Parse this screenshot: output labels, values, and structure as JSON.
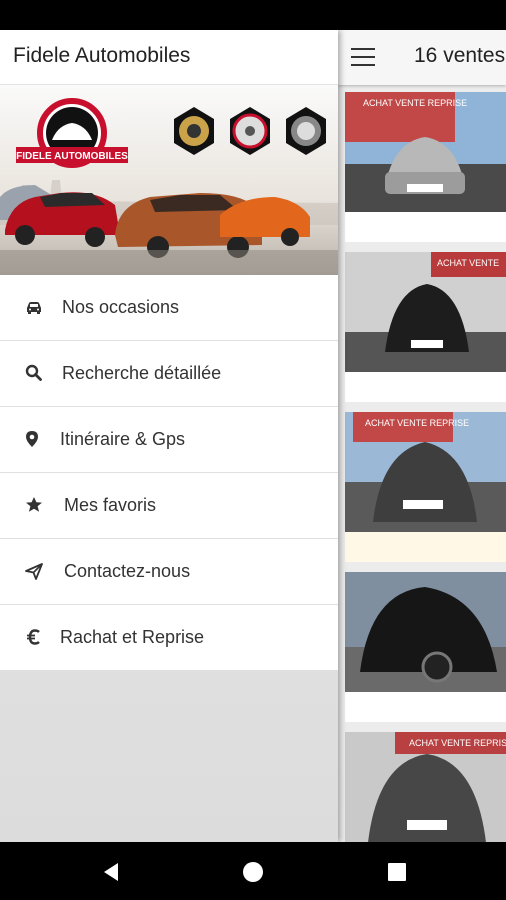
{
  "app": {
    "title": "Fidele Automobiles"
  },
  "banner": {
    "logo_text": "FIDELE AUTOMOBILES"
  },
  "menu": [
    {
      "label": "Nos occasions",
      "icon": "car-icon"
    },
    {
      "label": "Recherche détaillée",
      "icon": "search-icon"
    },
    {
      "label": "Itinéraire & Gps",
      "icon": "location-pin-icon"
    },
    {
      "label": "Mes favoris",
      "icon": "star-icon"
    },
    {
      "label": "Contactez-nous",
      "icon": "send-icon"
    },
    {
      "label": "Rachat et Reprise",
      "icon": "euro-icon"
    }
  ],
  "list": {
    "title": "16 ventes",
    "cards": [
      {
        "sign": "ACHAT VENTE REPRISE",
        "car": "silver-car"
      },
      {
        "sign": "ACHAT VENTE",
        "car": "black-car"
      },
      {
        "sign": "ACHAT VENTE REPRISE",
        "car": "grey-car"
      },
      {
        "sign": "",
        "car": "black-car"
      },
      {
        "sign": "ACHAT VENTE REPRISE",
        "car": "grey-suv"
      }
    ]
  },
  "colors": {
    "accent_red": "#c8102e",
    "brand_dark": "#222222"
  }
}
